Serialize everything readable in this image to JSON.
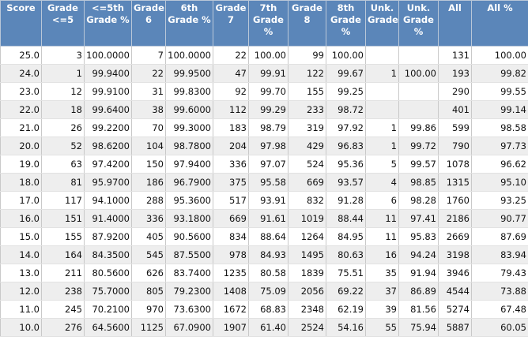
{
  "table": {
    "headers": [
      "Score",
      "Grade <=5",
      "<=5th Grade %",
      "Grade 6",
      "6th Grade %",
      "Grade 7",
      "7th Grade %",
      "Grade 8",
      "8th Grade %",
      "Unk. Grade",
      "Unk. Grade %",
      "All",
      "All %"
    ],
    "rows": [
      [
        "25.0",
        "3",
        "100.0000",
        "7",
        "100.0000",
        "22",
        "100.00",
        "99",
        "100.00",
        "",
        "",
        "131",
        "100.00"
      ],
      [
        "24.0",
        "1",
        "99.9400",
        "22",
        "99.9500",
        "47",
        "99.91",
        "122",
        "99.67",
        "1",
        "100.00",
        "193",
        "99.82"
      ],
      [
        "23.0",
        "12",
        "99.9100",
        "31",
        "99.8300",
        "92",
        "99.70",
        "155",
        "99.25",
        "",
        "",
        "290",
        "99.55"
      ],
      [
        "22.0",
        "18",
        "99.6400",
        "38",
        "99.6000",
        "112",
        "99.29",
        "233",
        "98.72",
        "",
        "",
        "401",
        "99.14"
      ],
      [
        "21.0",
        "26",
        "99.2200",
        "70",
        "99.3000",
        "183",
        "98.79",
        "319",
        "97.92",
        "1",
        "99.86",
        "599",
        "98.58"
      ],
      [
        "20.0",
        "52",
        "98.6200",
        "104",
        "98.7800",
        "204",
        "97.98",
        "429",
        "96.83",
        "1",
        "99.72",
        "790",
        "97.73"
      ],
      [
        "19.0",
        "63",
        "97.4200",
        "150",
        "97.9400",
        "336",
        "97.07",
        "524",
        "95.36",
        "5",
        "99.57",
        "1078",
        "96.62"
      ],
      [
        "18.0",
        "81",
        "95.9700",
        "186",
        "96.7900",
        "375",
        "95.58",
        "669",
        "93.57",
        "4",
        "98.85",
        "1315",
        "95.10"
      ],
      [
        "17.0",
        "117",
        "94.1000",
        "288",
        "95.3600",
        "517",
        "93.91",
        "832",
        "91.28",
        "6",
        "98.28",
        "1760",
        "93.25"
      ],
      [
        "16.0",
        "151",
        "91.4000",
        "336",
        "93.1800",
        "669",
        "91.61",
        "1019",
        "88.44",
        "11",
        "97.41",
        "2186",
        "90.77"
      ],
      [
        "15.0",
        "155",
        "87.9200",
        "405",
        "90.5600",
        "834",
        "88.64",
        "1264",
        "84.95",
        "11",
        "95.83",
        "2669",
        "87.69"
      ],
      [
        "14.0",
        "164",
        "84.3500",
        "545",
        "87.5500",
        "978",
        "84.93",
        "1495",
        "80.63",
        "16",
        "94.24",
        "3198",
        "83.94"
      ],
      [
        "13.0",
        "211",
        "80.5600",
        "626",
        "83.7400",
        "1235",
        "80.58",
        "1839",
        "75.51",
        "35",
        "91.94",
        "3946",
        "79.43"
      ],
      [
        "12.0",
        "238",
        "75.7000",
        "805",
        "79.2300",
        "1408",
        "75.09",
        "2056",
        "69.22",
        "37",
        "86.89",
        "4544",
        "73.88"
      ],
      [
        "11.0",
        "245",
        "70.2100",
        "970",
        "73.6300",
        "1672",
        "68.83",
        "2348",
        "62.19",
        "39",
        "81.56",
        "5274",
        "67.48"
      ],
      [
        "10.0",
        "276",
        "64.5600",
        "1125",
        "67.0900",
        "1907",
        "61.40",
        "2524",
        "54.16",
        "55",
        "75.94",
        "5887",
        "60.05"
      ]
    ]
  },
  "colors": {
    "header_bg": "#5b86b9",
    "header_text": "#ffffff",
    "row_alt_bg": "#eeeeee"
  }
}
